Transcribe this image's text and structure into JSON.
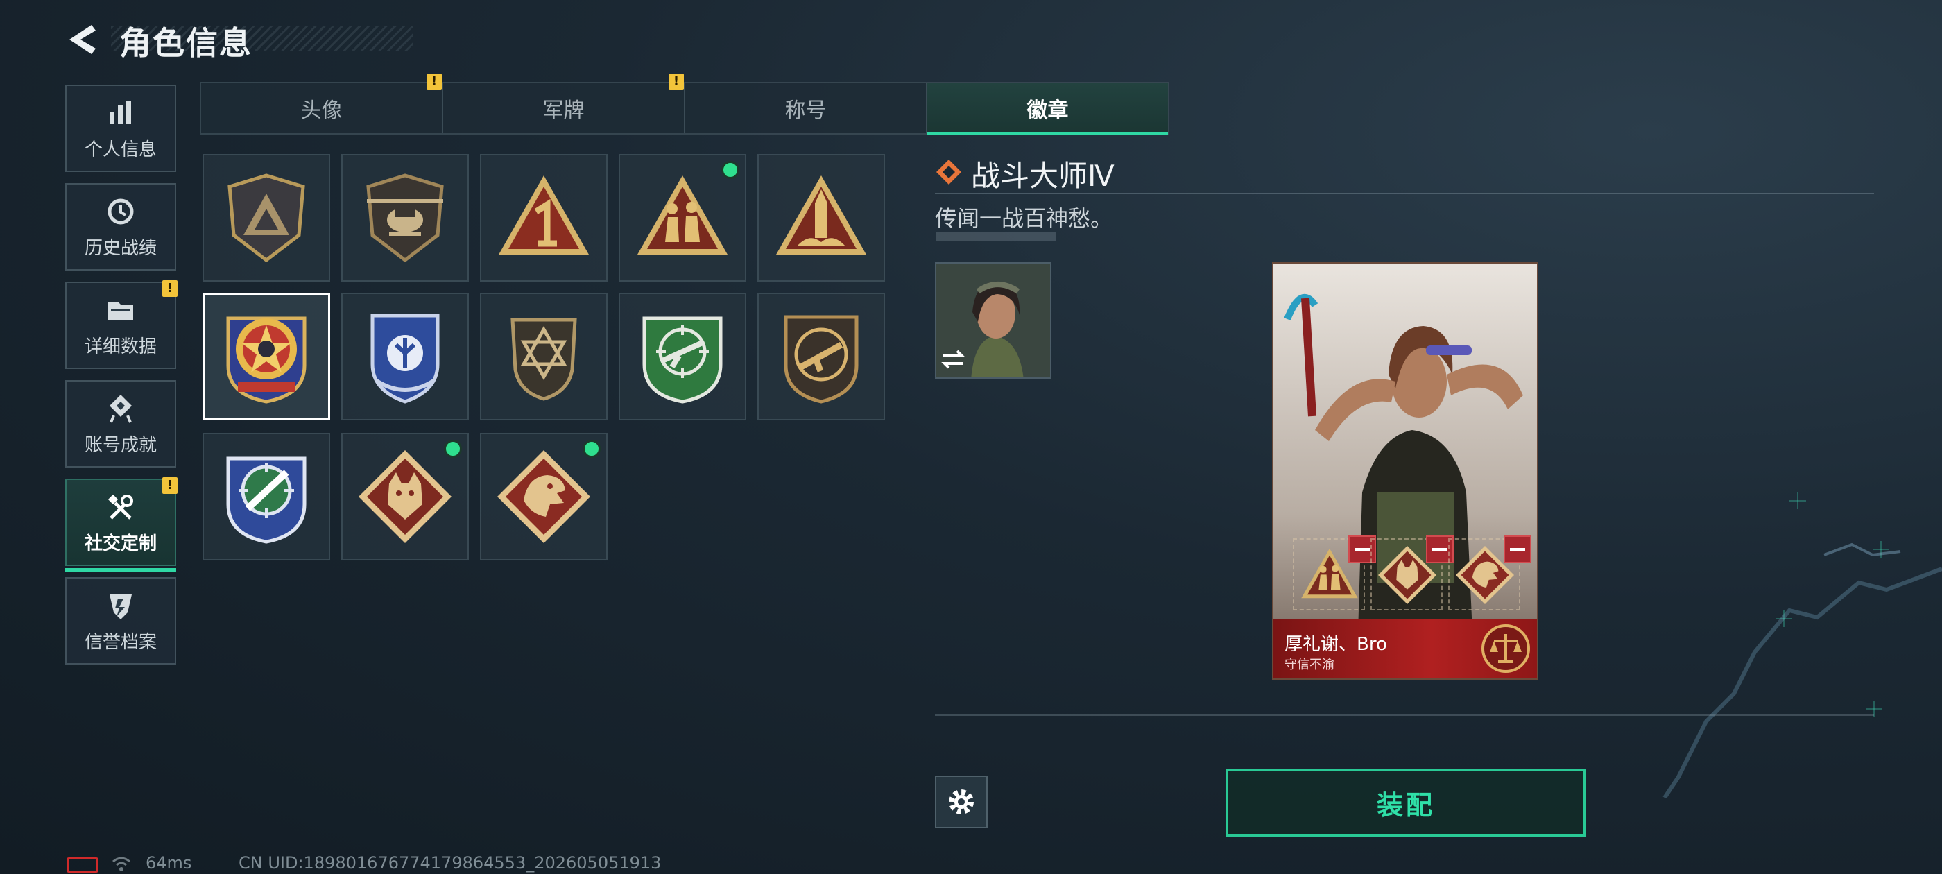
{
  "header": {
    "title": "角色信息"
  },
  "sidebar": {
    "items": [
      {
        "label": "个人信息",
        "icon": "bar-chart-icon",
        "active": false,
        "warning": false
      },
      {
        "label": "历史战绩",
        "icon": "history-clock-icon",
        "active": false,
        "warning": false
      },
      {
        "label": "详细数据",
        "icon": "folder-data-icon",
        "active": false,
        "warning": true
      },
      {
        "label": "账号成就",
        "icon": "achievement-medal-icon",
        "active": false,
        "warning": false
      },
      {
        "label": "社交定制",
        "icon": "tools-wrench-icon",
        "active": true,
        "warning": true
      },
      {
        "label": "信誉档案",
        "icon": "credit-shield-icon",
        "active": false,
        "warning": false
      }
    ],
    "warning_mark": "!"
  },
  "tabs": [
    {
      "label": "头像",
      "active": false,
      "warning": true
    },
    {
      "label": "军牌",
      "active": false,
      "warning": true
    },
    {
      "label": "称号",
      "active": false,
      "warning": false
    },
    {
      "label": "徽章",
      "active": true,
      "warning": false
    }
  ],
  "badges": [
    {
      "icon": "triangle-insignia-badge-icon",
      "new": false,
      "selected": false
    },
    {
      "icon": "helicopter-badge-icon",
      "new": false,
      "selected": false
    },
    {
      "icon": "number-one-triangle-badge-icon",
      "new": false,
      "selected": false
    },
    {
      "icon": "soldiers-triangle-badge-icon",
      "new": true,
      "selected": false
    },
    {
      "icon": "missile-triangle-badge-icon",
      "new": false,
      "selected": false
    },
    {
      "icon": "star-shield-badge-icon",
      "new": false,
      "selected": true
    },
    {
      "icon": "blue-wing-shield-badge-icon",
      "new": false,
      "selected": false
    },
    {
      "icon": "hexagram-shield-badge-icon",
      "new": false,
      "selected": false
    },
    {
      "icon": "green-rifle-target-badge-icon",
      "new": false,
      "selected": false
    },
    {
      "icon": "smg-shield-badge-icon",
      "new": false,
      "selected": false
    },
    {
      "icon": "blue-knife-target-badge-icon",
      "new": false,
      "selected": false
    },
    {
      "icon": "wolf-diamond-badge-icon",
      "new": true,
      "selected": false
    },
    {
      "icon": "dragon-diamond-badge-icon",
      "new": true,
      "selected": false
    }
  ],
  "detail": {
    "name": "战斗大师Ⅳ",
    "description": "传闻一战百神愁。",
    "rarity_icon": "orange-diamond-icon"
  },
  "card": {
    "player_name": "厚礼谢、Bro",
    "motto": "守信不渝",
    "emblem_icon": "scales-emblem-icon",
    "slots": [
      {
        "icon": "soldiers-triangle-badge-icon"
      },
      {
        "icon": "wolf-diamond-badge-icon"
      },
      {
        "icon": "dragon-diamond-badge-icon"
      }
    ]
  },
  "actions": {
    "equip_label": "装配",
    "settings_icon": "gear-icon"
  },
  "status": {
    "ping": "64ms",
    "uid": "CN UID:18980167677417986455­3_202605051913"
  },
  "colors": {
    "accent": "#2fd8a4",
    "warning": "#f3c43a",
    "new_dot": "#2fe08e",
    "card_footer": "#b02020"
  }
}
